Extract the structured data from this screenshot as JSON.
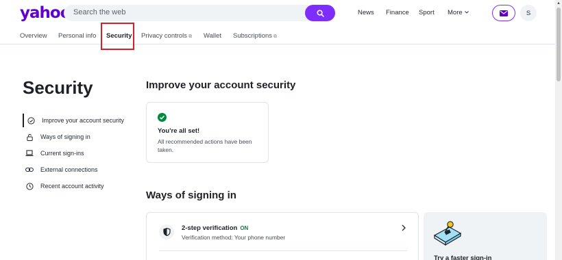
{
  "header": {
    "logo": "yahoo!",
    "search_placeholder": "Search the web",
    "nav": [
      "News",
      "Finance",
      "Sport",
      "More"
    ],
    "avatar_initial": "S"
  },
  "tabs": [
    {
      "label": "Overview"
    },
    {
      "label": "Personal info"
    },
    {
      "label": "Security"
    },
    {
      "label": "Privacy controls"
    },
    {
      "label": "Wallet"
    },
    {
      "label": "Subscriptions"
    }
  ],
  "page_title": "Security",
  "section_nav": [
    {
      "label": "Improve your account security",
      "icon": "check-circle-icon"
    },
    {
      "label": "Ways of signing in",
      "icon": "lock-icon"
    },
    {
      "label": "Current sign-ins",
      "icon": "laptop-icon"
    },
    {
      "label": "External connections",
      "icon": "link-icon"
    },
    {
      "label": "Recent account activity",
      "icon": "clock-icon"
    }
  ],
  "improve": {
    "heading": "Improve your account security",
    "status_title": "You're all set!",
    "status_desc": "All recommended actions have been taken."
  },
  "ways": {
    "heading": "Ways of signing in",
    "two_step": {
      "title": "2-step verification",
      "status": "ON",
      "desc": "Verification method: Your phone number"
    },
    "promo_text": "Try a faster sign-in"
  },
  "colors": {
    "brand": "#6001d2",
    "accent": "#7d2eff",
    "success": "#008a3b",
    "highlight": "#d41f26"
  }
}
